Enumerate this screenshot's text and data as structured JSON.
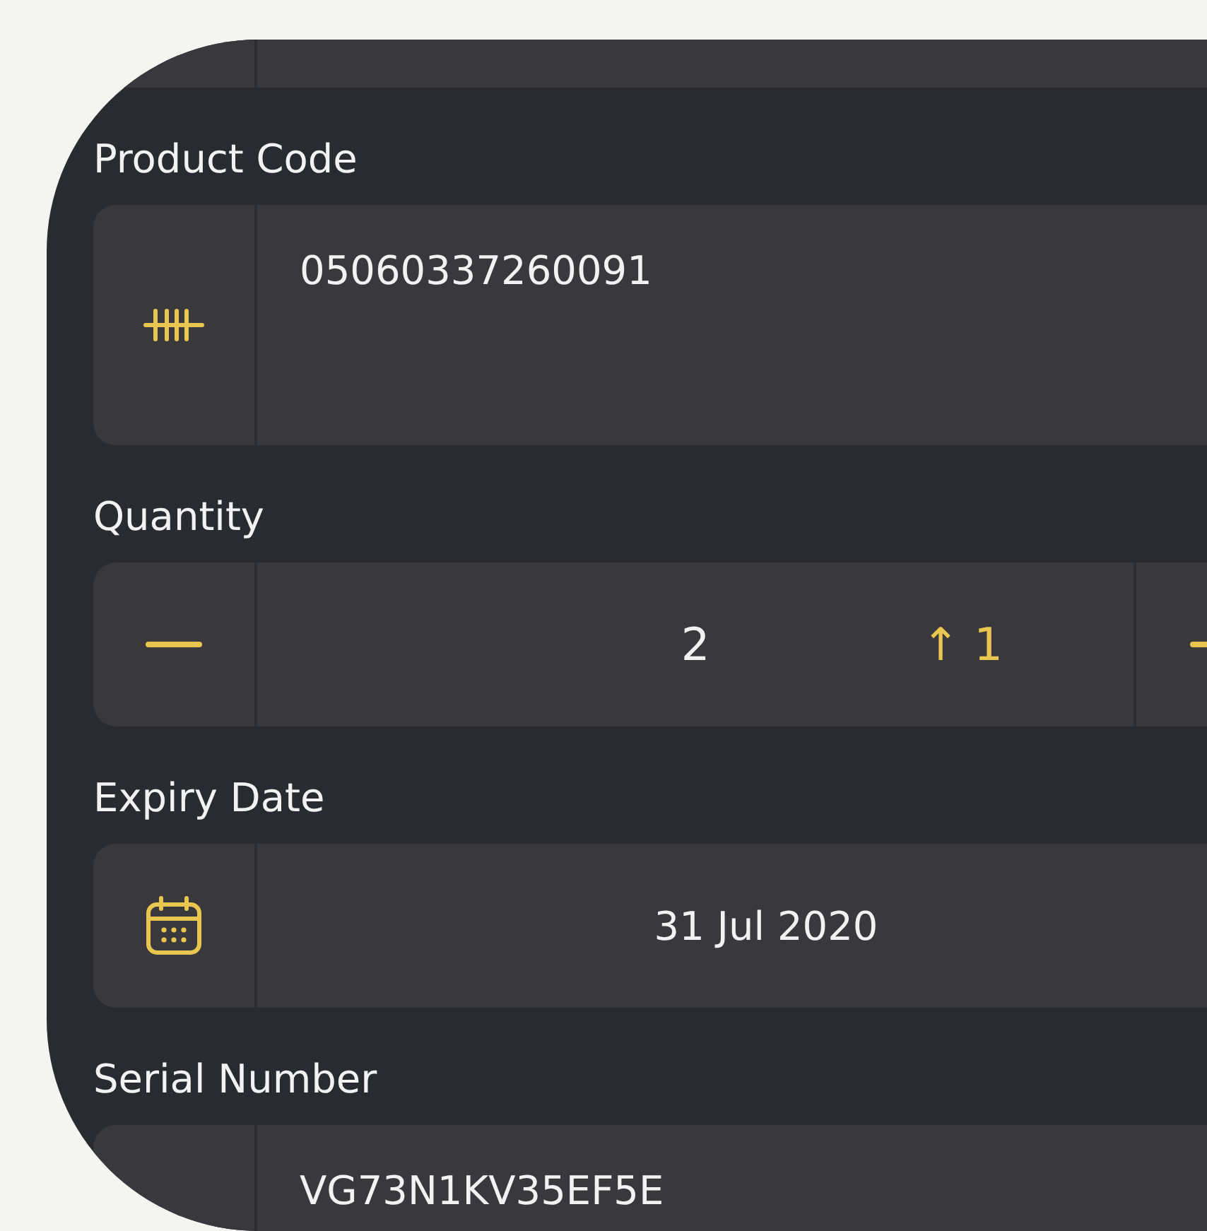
{
  "fields": [
    {
      "kind": "text",
      "label": "Product Code",
      "value": "05060337260091"
    },
    {
      "kind": "stepper",
      "label": "Quantity",
      "value": "2",
      "change": "↑ 1"
    },
    {
      "kind": "date",
      "label": "Expiry Date",
      "value": "31 Jul 2020"
    },
    {
      "kind": "text",
      "label": "Serial Number",
      "value": "VG73N1KV35EF5E"
    }
  ]
}
